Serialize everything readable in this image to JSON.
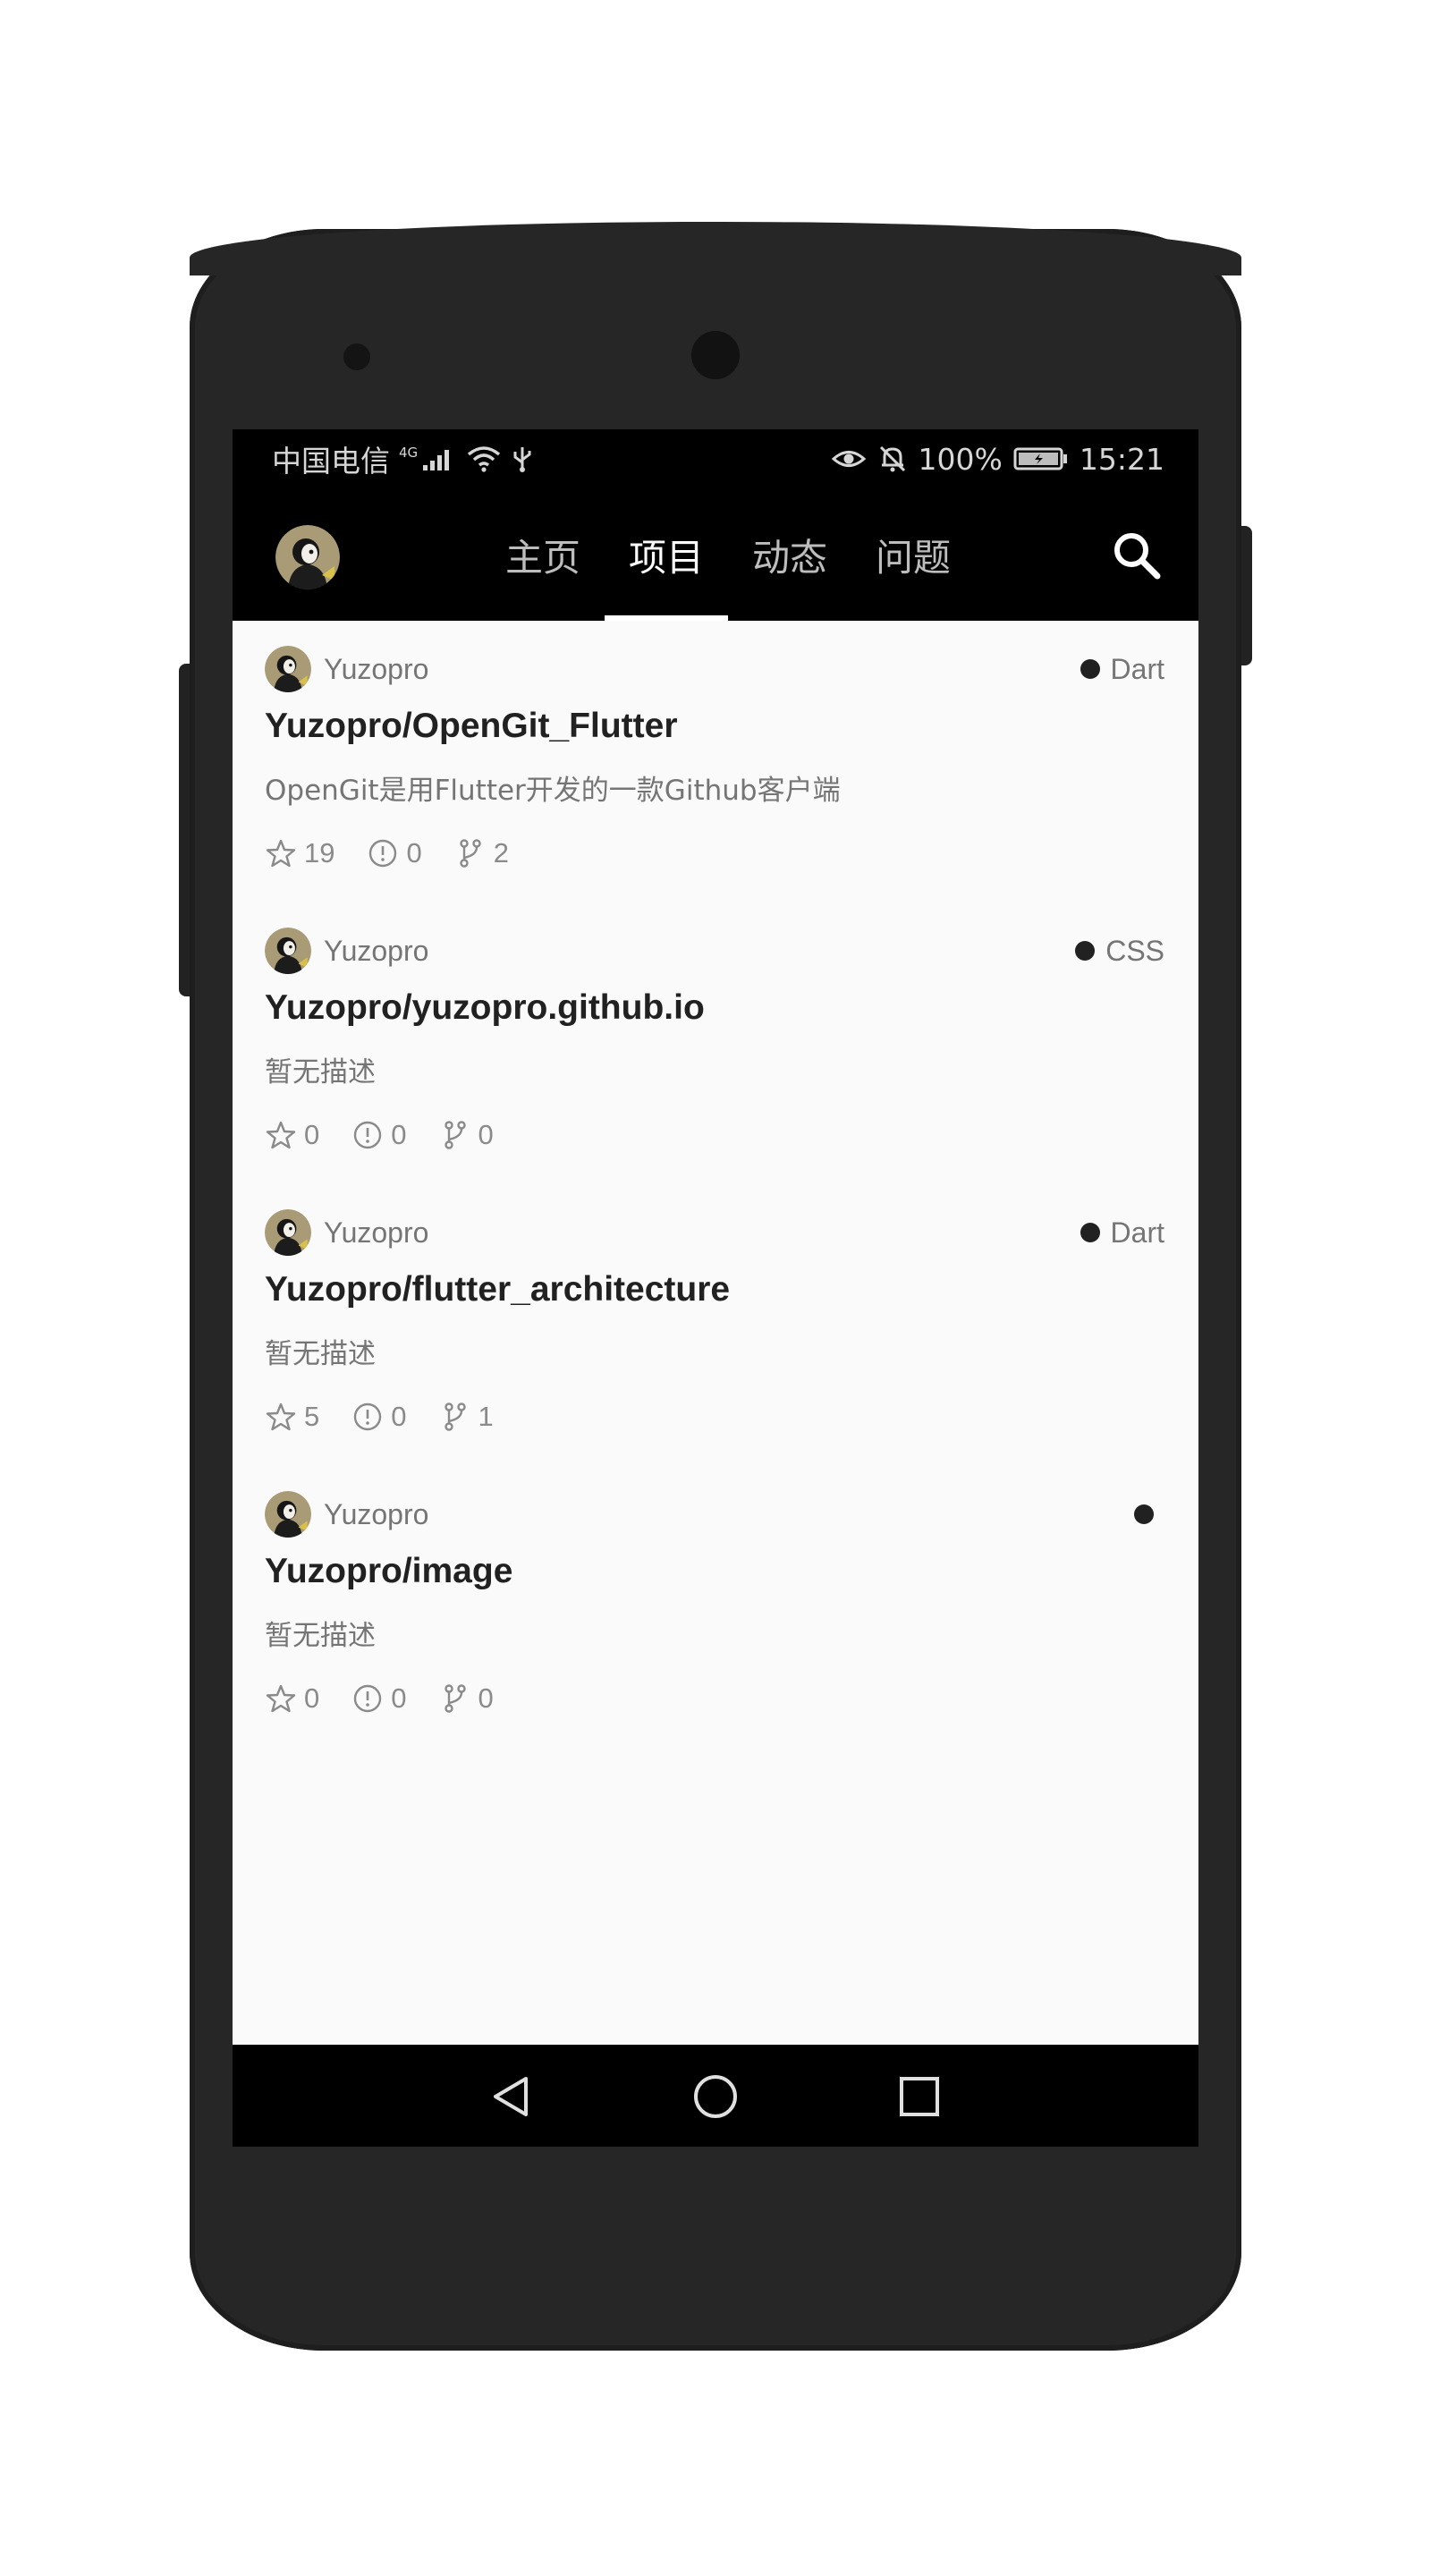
{
  "status_bar": {
    "carrier": "中国电信",
    "network": "4G",
    "battery": "100%",
    "time": "15:21"
  },
  "app_bar": {
    "tabs": [
      {
        "label": "主页",
        "active": false
      },
      {
        "label": "项目",
        "active": true
      },
      {
        "label": "动态",
        "active": false
      },
      {
        "label": "问题",
        "active": false
      }
    ],
    "icons": [
      "avatar",
      "search-icon"
    ]
  },
  "repos": [
    {
      "owner": "Yuzopro",
      "language": "Dart",
      "full_name": "Yuzopro/OpenGit_Flutter",
      "description": "OpenGit是用Flutter开发的一款Github客户端",
      "stars": "19",
      "issues": "0",
      "forks": "2"
    },
    {
      "owner": "Yuzopro",
      "language": "CSS",
      "full_name": "Yuzopro/yuzopro.github.io",
      "description": "暂无描述",
      "stars": "0",
      "issues": "0",
      "forks": "0"
    },
    {
      "owner": "Yuzopro",
      "language": "Dart",
      "full_name": "Yuzopro/flutter_architecture",
      "description": "暂无描述",
      "stars": "5",
      "issues": "0",
      "forks": "1"
    },
    {
      "owner": "Yuzopro",
      "language": "",
      "full_name": "Yuzopro/image",
      "description": "暂无描述",
      "stars": "0",
      "issues": "0",
      "forks": "0"
    }
  ],
  "colors": {
    "app_bar": "#000000",
    "list_bg": "#fafafa",
    "title_text": "#212121",
    "secondary_text": "#757575",
    "phone_body": "#262626"
  }
}
